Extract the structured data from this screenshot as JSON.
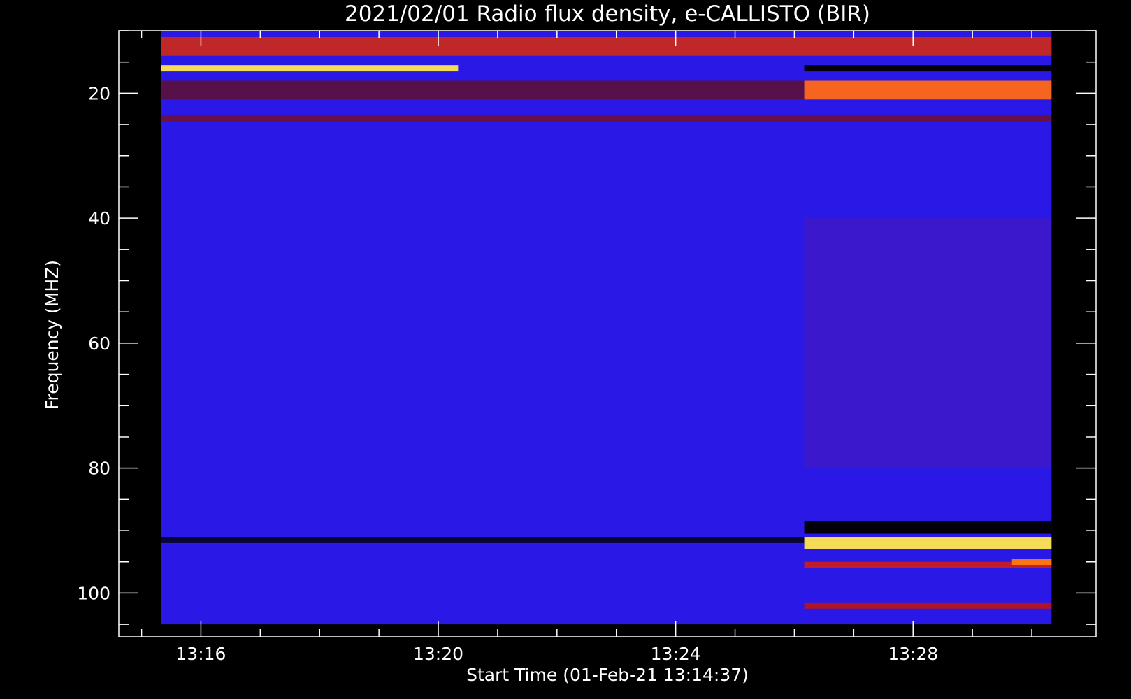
{
  "chart_data": {
    "type": "heatmap",
    "title": "2021/02/01  Radio flux density, e-CALLISTO (BIR)",
    "xlabel": "Start Time (01-Feb-21 13:14:37)",
    "ylabel": "Frequency (MHZ)",
    "x_units": "time (HH:MM, 01-Feb-21)",
    "y_units": "MHz",
    "xlim": [
      "13:14:37",
      "13:31:05"
    ],
    "ylim_inverted": [
      107,
      10
    ],
    "data_time_range": [
      "13:15:20",
      "13:30:20"
    ],
    "data_freq_range": [
      10,
      105
    ],
    "x_major_ticks": [
      "13:16",
      "13:20",
      "13:24",
      "13:28"
    ],
    "x_minor_ticks": [
      "13:15",
      "13:17",
      "13:18",
      "13:19",
      "13:21",
      "13:22",
      "13:23",
      "13:25",
      "13:26",
      "13:27",
      "13:29",
      "13:30"
    ],
    "y_major_ticks": [
      20,
      40,
      60,
      80,
      100
    ],
    "y_minor_ticks": [
      10,
      15,
      25,
      30,
      35,
      45,
      50,
      55,
      65,
      70,
      75,
      85,
      90,
      95,
      105
    ],
    "colormap": [
      "#000000",
      "#1a0ad8",
      "#5a14b4",
      "#b41e1e",
      "#ff5000",
      "#ffe650"
    ],
    "background_color": "#2a18e6",
    "features": [
      {
        "t0": "13:15:20",
        "t1": "13:30:20",
        "f0": 11,
        "f1": 14,
        "intensity": "red noisy"
      },
      {
        "t0": "13:15:20",
        "t1": "13:20:20",
        "f0": 15.5,
        "f1": 16.5,
        "intensity": "bright yellow band"
      },
      {
        "t0": "13:26:10",
        "t1": "13:30:20",
        "f0": 15.5,
        "f1": 16.5,
        "intensity": "black band"
      },
      {
        "t0": "13:15:20",
        "t1": "13:30:20",
        "f0": 18,
        "f1": 21,
        "intensity": "mixed black/red"
      },
      {
        "t0": "13:26:10",
        "t1": "13:30:20",
        "f0": 18,
        "f1": 21,
        "intensity": "bright red/yellow"
      },
      {
        "t0": "13:15:20",
        "t1": "13:30:20",
        "f0": 23.5,
        "f1": 24.5,
        "intensity": "dark/red line"
      },
      {
        "t0": "13:26:10",
        "t1": "13:30:20",
        "f0": 40,
        "f1": 80,
        "intensity": "purple enhanced"
      },
      {
        "t0": "13:15:20",
        "t1": "13:26:10",
        "f0": 91,
        "f1": 92,
        "intensity": "black line"
      },
      {
        "t0": "13:26:10",
        "t1": "13:30:20",
        "f0": 88.5,
        "f1": 90.5,
        "intensity": "black band"
      },
      {
        "t0": "13:26:10",
        "t1": "13:30:20",
        "f0": 91,
        "f1": 93,
        "intensity": "bright yellow band"
      },
      {
        "t0": "13:26:10",
        "t1": "13:30:20",
        "f0": 95,
        "f1": 96,
        "intensity": "red band"
      },
      {
        "t0": "13:29:40",
        "t1": "13:30:20",
        "f0": 94.5,
        "f1": 95.5,
        "intensity": "orange"
      },
      {
        "t0": "13:26:10",
        "t1": "13:30:20",
        "f0": 101.5,
        "f1": 102.5,
        "intensity": "red line"
      }
    ]
  }
}
